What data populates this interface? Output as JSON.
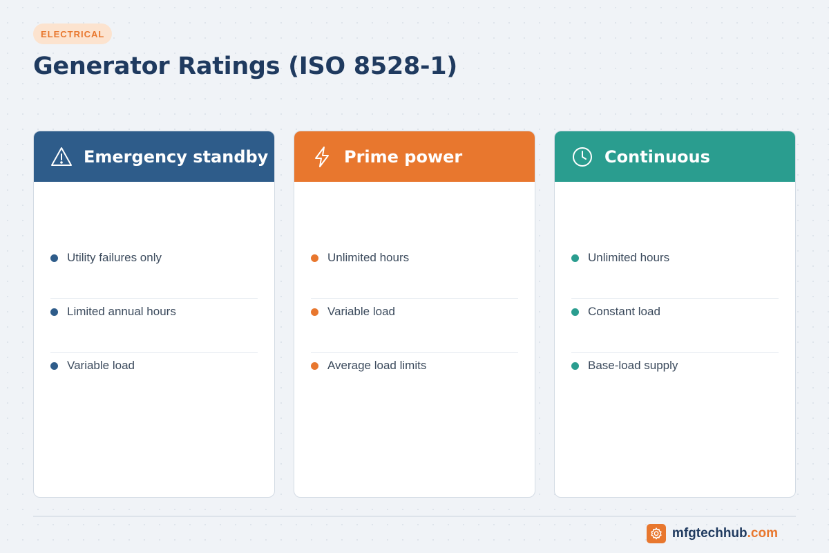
{
  "badge": "ELECTRICAL",
  "title": "Generator Ratings (ISO 8528-1)",
  "colors": {
    "standby": "#2e5c8a",
    "prime": "#e8772e",
    "continuous": "#2a9d8f",
    "accent": "#e8772e",
    "text": "#1f3a5f"
  },
  "cards": [
    {
      "title": "Emergency standby",
      "icon": "warning-triangle-icon",
      "items": [
        "Utility failures only",
        "Limited annual hours",
        "Variable load"
      ]
    },
    {
      "title": "Prime power",
      "icon": "lightning-bolt-icon",
      "items": [
        "Unlimited hours",
        "Variable load",
        "Average load limits"
      ]
    },
    {
      "title": "Continuous",
      "icon": "clock-icon",
      "items": [
        "Unlimited hours",
        "Constant load",
        "Base-load supply"
      ]
    }
  ],
  "brand": {
    "name": "mfgtechhub",
    "tld": ".com",
    "icon": "gear-icon"
  }
}
